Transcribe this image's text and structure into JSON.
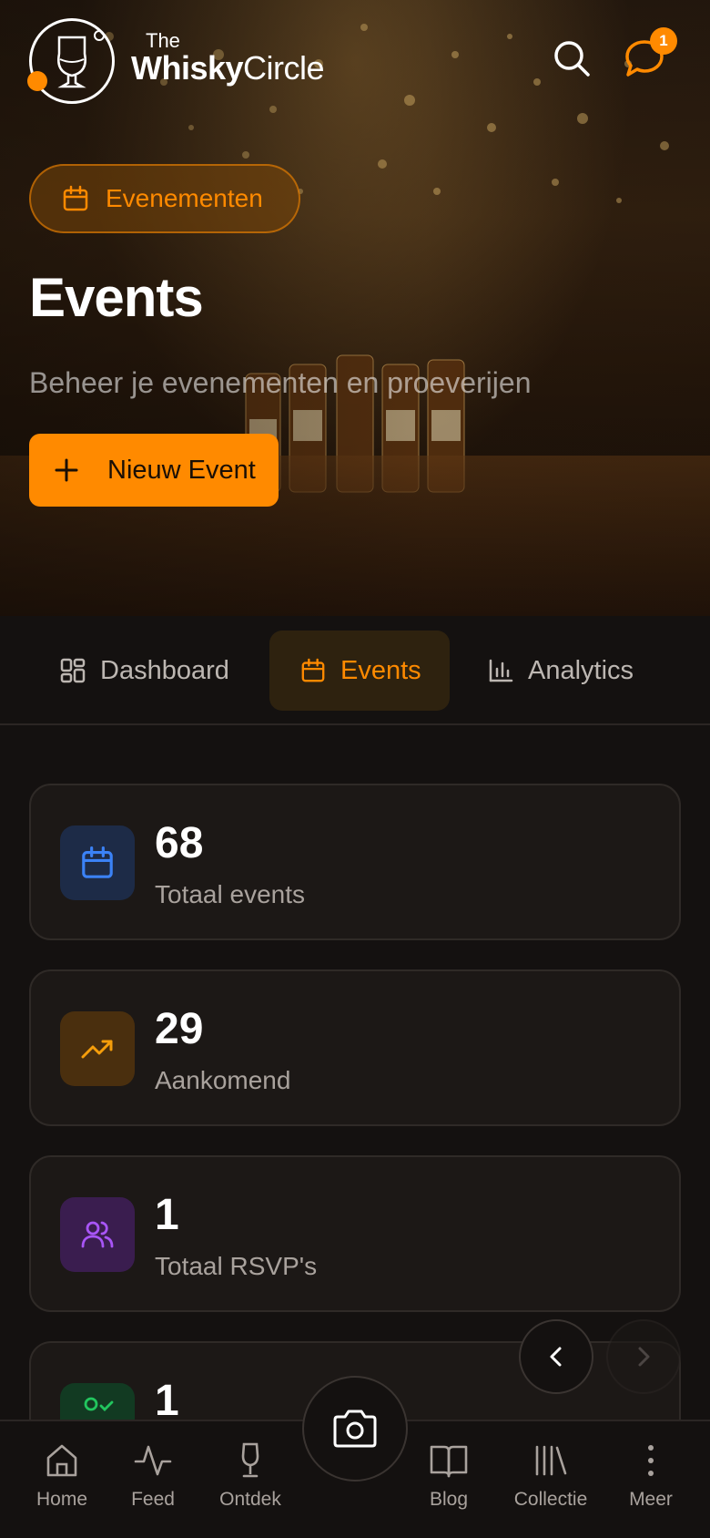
{
  "header": {
    "brand_the": "The",
    "brand_whisky": "Whisky",
    "brand_circle": "Circle",
    "notification_count": "1"
  },
  "hero": {
    "badge_label": "Evenementen",
    "title": "Events",
    "subtitle": "Beheer je evenementen en proeverijen",
    "new_event_label": "Nieuw Event"
  },
  "tabs": [
    {
      "label": "Dashboard",
      "active": false
    },
    {
      "label": "Events",
      "active": true
    },
    {
      "label": "Analytics",
      "active": false
    }
  ],
  "stats": [
    {
      "value": "68",
      "label": "Totaal events",
      "icon": "calendar-icon",
      "color": "#3b82f6"
    },
    {
      "value": "29",
      "label": "Aankomend",
      "icon": "trending-up-icon",
      "color": "#f59e0b"
    },
    {
      "value": "1",
      "label": "Totaal RSVP's",
      "icon": "users-icon",
      "color": "#a855f7"
    },
    {
      "value": "1",
      "label": "",
      "icon": "user-check-icon",
      "color": "#22c55e"
    }
  ],
  "bottom_nav": [
    {
      "label": "Home",
      "icon": "home-icon"
    },
    {
      "label": "Feed",
      "icon": "activity-icon"
    },
    {
      "label": "Ontdek",
      "icon": "glass-icon"
    },
    {
      "label": "Blog",
      "icon": "book-icon"
    },
    {
      "label": "Collectie",
      "icon": "library-icon"
    },
    {
      "label": "Meer",
      "icon": "more-icon"
    }
  ],
  "colors": {
    "accent": "#ff8a00",
    "background": "#141110",
    "card": "#1c1816"
  }
}
